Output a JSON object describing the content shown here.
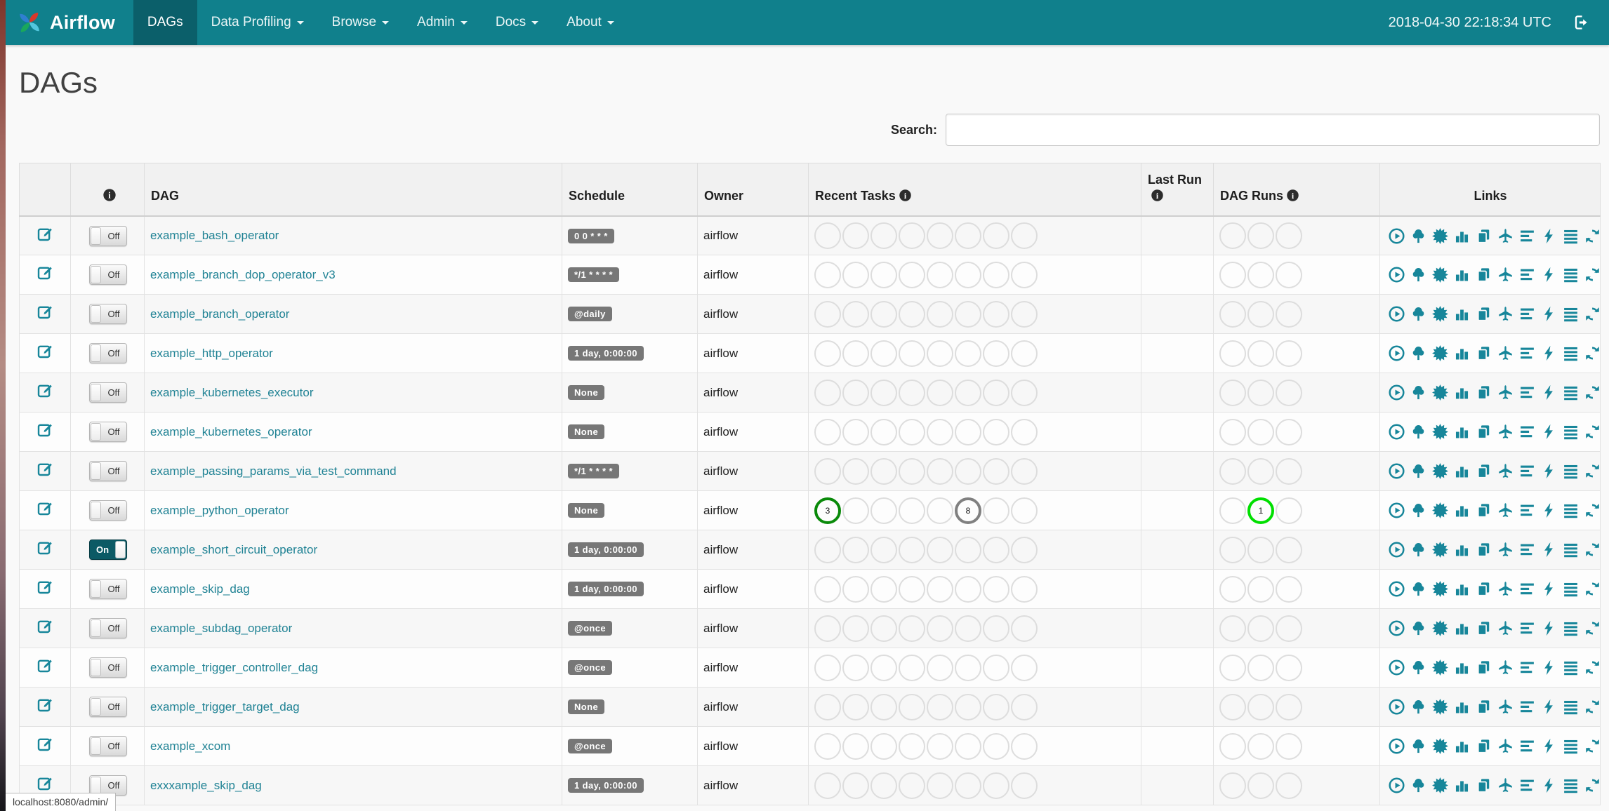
{
  "colors": {
    "navbar_bg": "#10808c",
    "navbar_active_bg": "#0b5f6a",
    "accent_teal": "#17869a",
    "badge_bg": "#777777",
    "toggle_on_bg": "#0b5a65",
    "empty_ring": "#dddddd",
    "success_ring": "#0a8a0a",
    "queued_ring": "#808080",
    "running_ring": "#00df00"
  },
  "navbar": {
    "brand": "Airflow",
    "items": [
      {
        "label": "DAGs",
        "active": true,
        "caret": false
      },
      {
        "label": "Data Profiling",
        "active": false,
        "caret": true
      },
      {
        "label": "Browse",
        "active": false,
        "caret": true
      },
      {
        "label": "Admin",
        "active": false,
        "caret": true
      },
      {
        "label": "Docs",
        "active": false,
        "caret": true
      },
      {
        "label": "About",
        "active": false,
        "caret": true
      }
    ],
    "clock": "2018-04-30 22:18:34 UTC"
  },
  "page": {
    "title": "DAGs",
    "search_label": "Search:",
    "search_value": "",
    "statusbar": "localhost:8080/admin/"
  },
  "table": {
    "headers": {
      "dag": "DAG",
      "schedule": "Schedule",
      "owner": "Owner",
      "recent_tasks": "Recent Tasks",
      "last_run": "Last Run",
      "dag_runs": "DAG Runs",
      "links": "Links"
    },
    "recent_task_slots": 8,
    "dag_run_slots": 3,
    "links": [
      {
        "link_name": "trigger-dag-link",
        "icon_name": "play-circle-icon",
        "symbol": "play-circle"
      },
      {
        "link_name": "tree-view-link",
        "icon_name": "tree-icon",
        "symbol": "tree"
      },
      {
        "link_name": "graph-view-link",
        "icon_name": "burst-icon",
        "symbol": "burst"
      },
      {
        "link_name": "task-duration-link",
        "icon_name": "bar-chart-icon",
        "symbol": "bar-chart"
      },
      {
        "link_name": "task-tries-link",
        "icon_name": "duplicate-pages-icon",
        "symbol": "duplicate"
      },
      {
        "link_name": "landing-times-link",
        "icon_name": "plane-icon",
        "symbol": "plane"
      },
      {
        "link_name": "gantt-view-link",
        "icon_name": "align-left-icon",
        "symbol": "align-left"
      },
      {
        "link_name": "code-view-link",
        "icon_name": "bolt-icon",
        "symbol": "bolt"
      },
      {
        "link_name": "logs-link",
        "icon_name": "align-justify-icon",
        "symbol": "align-justify"
      },
      {
        "link_name": "refresh-link",
        "icon_name": "refresh-icon",
        "symbol": "refresh"
      }
    ],
    "rows": [
      {
        "dag_id": "example_bash_operator",
        "toggle": "Off",
        "schedule": "0 0 * * *",
        "owner": "airflow",
        "task_counts": [],
        "run_counts": []
      },
      {
        "dag_id": "example_branch_dop_operator_v3",
        "toggle": "Off",
        "schedule": "*/1 * * * *",
        "owner": "airflow",
        "task_counts": [],
        "run_counts": []
      },
      {
        "dag_id": "example_branch_operator",
        "toggle": "Off",
        "schedule": "@daily",
        "owner": "airflow",
        "task_counts": [],
        "run_counts": []
      },
      {
        "dag_id": "example_http_operator",
        "toggle": "Off",
        "schedule": "1 day, 0:00:00",
        "owner": "airflow",
        "task_counts": [],
        "run_counts": []
      },
      {
        "dag_id": "example_kubernetes_executor",
        "toggle": "Off",
        "schedule": "None",
        "owner": "airflow",
        "task_counts": [],
        "run_counts": []
      },
      {
        "dag_id": "example_kubernetes_operator",
        "toggle": "Off",
        "schedule": "None",
        "owner": "airflow",
        "task_counts": [],
        "run_counts": []
      },
      {
        "dag_id": "example_passing_params_via_test_command",
        "toggle": "Off",
        "schedule": "*/1 * * * *",
        "owner": "airflow",
        "task_counts": [],
        "run_counts": []
      },
      {
        "dag_id": "example_python_operator",
        "toggle": "Off",
        "schedule": "None",
        "owner": "airflow",
        "task_counts": [
          {
            "slot": 0,
            "count": "3",
            "color": "#0a8a0a"
          },
          {
            "slot": 5,
            "count": "8",
            "color": "#808080"
          }
        ],
        "run_counts": [
          {
            "slot": 1,
            "count": "1",
            "color": "#00df00"
          }
        ]
      },
      {
        "dag_id": "example_short_circuit_operator",
        "toggle": "On",
        "schedule": "1 day, 0:00:00",
        "owner": "airflow",
        "task_counts": [],
        "run_counts": []
      },
      {
        "dag_id": "example_skip_dag",
        "toggle": "Off",
        "schedule": "1 day, 0:00:00",
        "owner": "airflow",
        "task_counts": [],
        "run_counts": []
      },
      {
        "dag_id": "example_subdag_operator",
        "toggle": "Off",
        "schedule": "@once",
        "owner": "airflow",
        "task_counts": [],
        "run_counts": []
      },
      {
        "dag_id": "example_trigger_controller_dag",
        "toggle": "Off",
        "schedule": "@once",
        "owner": "airflow",
        "task_counts": [],
        "run_counts": []
      },
      {
        "dag_id": "example_trigger_target_dag",
        "toggle": "Off",
        "schedule": "None",
        "owner": "airflow",
        "task_counts": [],
        "run_counts": []
      },
      {
        "dag_id": "example_xcom",
        "toggle": "Off",
        "schedule": "@once",
        "owner": "airflow",
        "task_counts": [],
        "run_counts": []
      },
      {
        "dag_id": "exxxample_skip_dag",
        "toggle": "Off",
        "schedule": "1 day, 0:00:00",
        "owner": "airflow",
        "task_counts": [],
        "run_counts": []
      }
    ]
  }
}
